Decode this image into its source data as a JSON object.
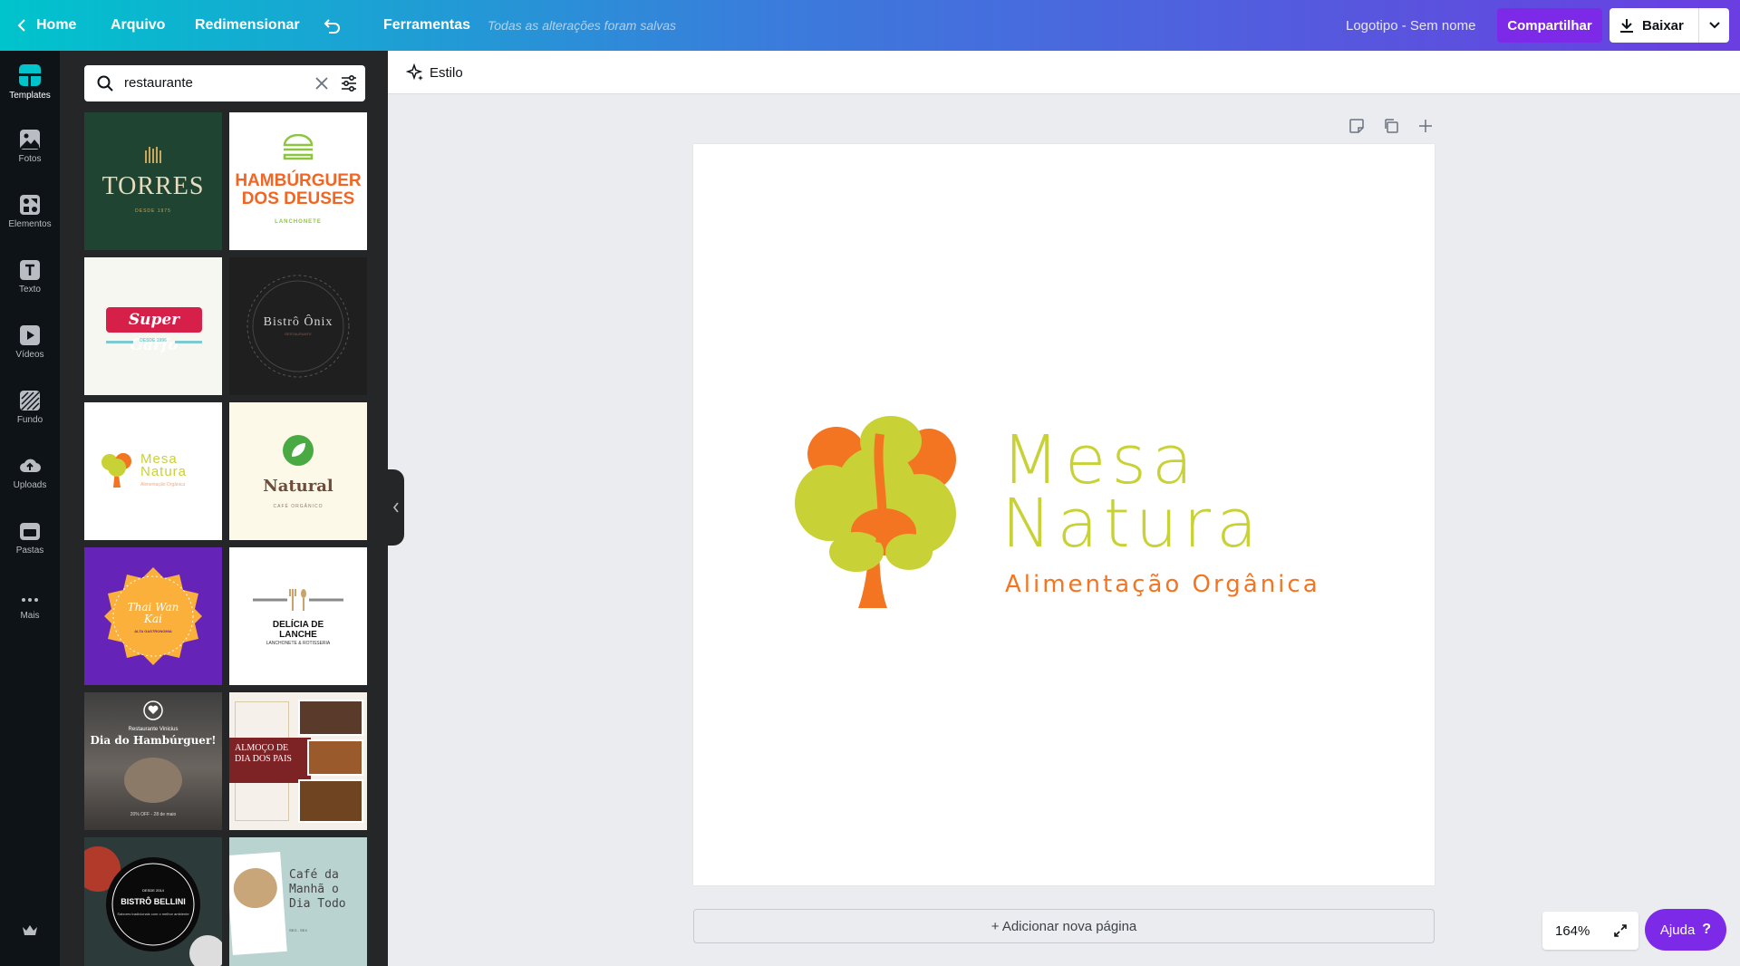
{
  "topbar": {
    "home": "Home",
    "file": "Arquivo",
    "resize": "Redimensionar",
    "tools": "Ferramentas",
    "saved_status": "Todas as alterações foram salvas",
    "doc_title": "Logotipo - Sem nome",
    "share": "Compartilhar",
    "download": "Baixar"
  },
  "rail": {
    "items": [
      {
        "label": "Templates",
        "icon": "templates-icon"
      },
      {
        "label": "Fotos",
        "icon": "photos-icon"
      },
      {
        "label": "Elementos",
        "icon": "elements-icon"
      },
      {
        "label": "Texto",
        "icon": "text-icon"
      },
      {
        "label": "Vídeos",
        "icon": "video-icon"
      },
      {
        "label": "Fundo",
        "icon": "background-icon"
      },
      {
        "label": "Uploads",
        "icon": "upload-icon"
      },
      {
        "label": "Pastas",
        "icon": "folder-icon"
      },
      {
        "label": "Mais",
        "icon": "more-icon"
      }
    ]
  },
  "search": {
    "value": "restaurante"
  },
  "templates": {
    "torres": {
      "title": "TORRES",
      "sub": "DESDE 1975"
    },
    "hamburguer": {
      "title1": "HAMBÚRGUER",
      "title2": "DOS DEUSES",
      "sub": "LANCHONETE"
    },
    "super_garfo": {
      "title": "Super Garfo",
      "sub": "DESDE 1996"
    },
    "bistro_onix": {
      "title": "Bistrô Ônix",
      "sub": "RESTAURANTE"
    },
    "mesa_natura_thumb": {
      "title1": "Mesa",
      "title2": "Natura",
      "sub": "Alimentação Orgânica"
    },
    "natural": {
      "title": "Natural",
      "sub": "CAFÉ ORGÂNICO"
    },
    "thai": {
      "title1": "Thai Wan",
      "title2": "Kai",
      "sub": "ALTA GASTRONOMIA"
    },
    "delicia": {
      "title1": "DELÍCIA DE",
      "title2": "LANCHE",
      "sub": "LANCHONETE & ROTISSERIA"
    },
    "dia_hamburguer": {
      "pre": "Restaurante Vinicius",
      "title": "Dia do Hambúrguer!",
      "sub": "20% OFF - 28 de maio"
    },
    "almoco": {
      "title1": "ALMOÇO DE",
      "title2": "DIA DOS PAIS"
    },
    "bellini": {
      "pre": "DESDE 2014",
      "title": "BISTRÔ BELLINI",
      "sub": "Sabores tradicionais com o melhor ambiente"
    },
    "cafe": {
      "l1": "Café da",
      "l2": "Manhã o",
      "l3": "Dia Todo",
      "sub": "SEG - SEX"
    }
  },
  "toolbar": {
    "style": "Estilo"
  },
  "canvas": {
    "logo_line1": "Mesa",
    "logo_line2": "Natura",
    "logo_tagline": "Alimentação Orgânica",
    "add_page": "+ Adicionar nova página"
  },
  "zoom": {
    "value": "164%"
  },
  "help": {
    "label": "Ajuda",
    "glyph": "?"
  },
  "colors": {
    "brand_purple": "#7d2ae8",
    "logo_green": "#c8d236",
    "logo_orange": "#f47521"
  }
}
